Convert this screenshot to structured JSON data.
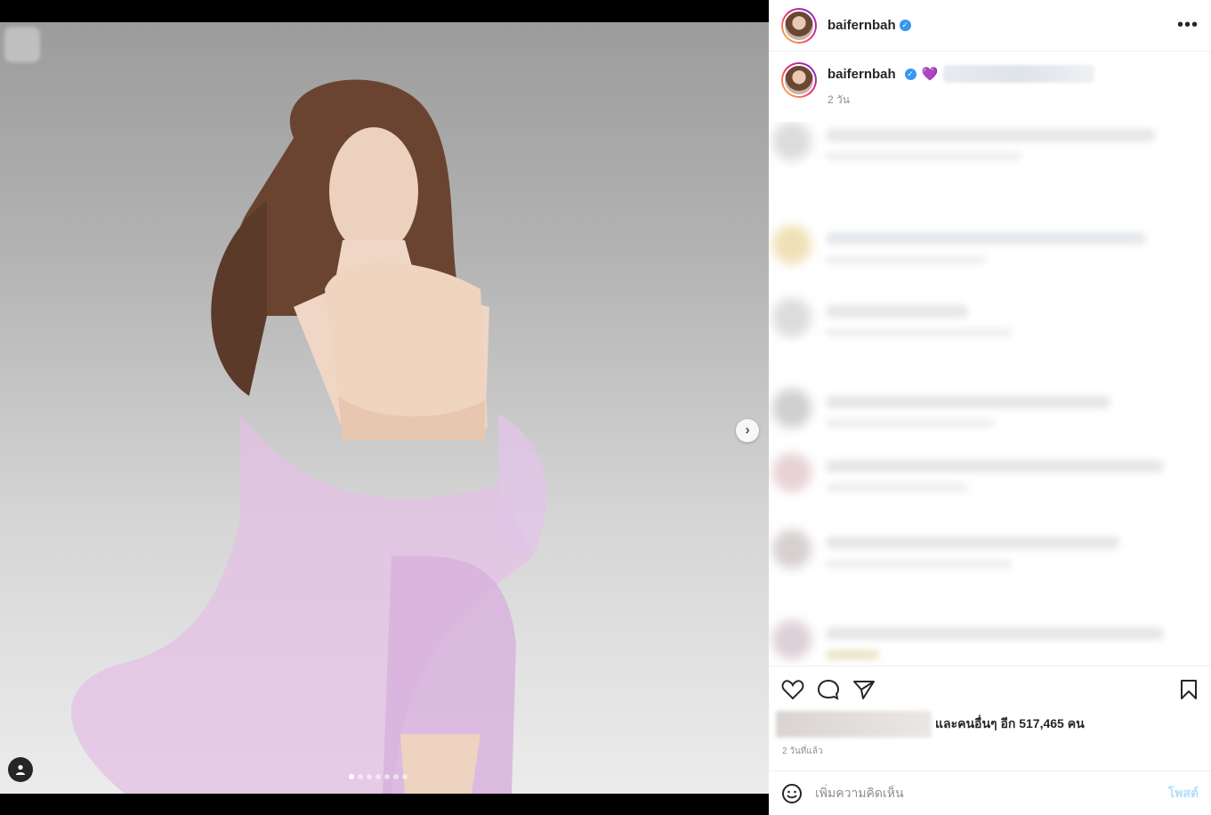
{
  "post": {
    "username": "baifernbah",
    "caption_time": "2 วัน",
    "more_label": "•••",
    "likes_suffix": "และคนอื่นๆ อีก 517,465 คน",
    "posted_time": "2 วันที่แล้ว",
    "comment_placeholder": "เพิ่มความคิดเห็น",
    "post_label": "โพสต์"
  },
  "carousel": {
    "total_slides": 7,
    "active_index": 0
  },
  "colors": {
    "accent": "#0095f6",
    "verified": "#3897f0",
    "post_disabled": "#b2dffc"
  }
}
